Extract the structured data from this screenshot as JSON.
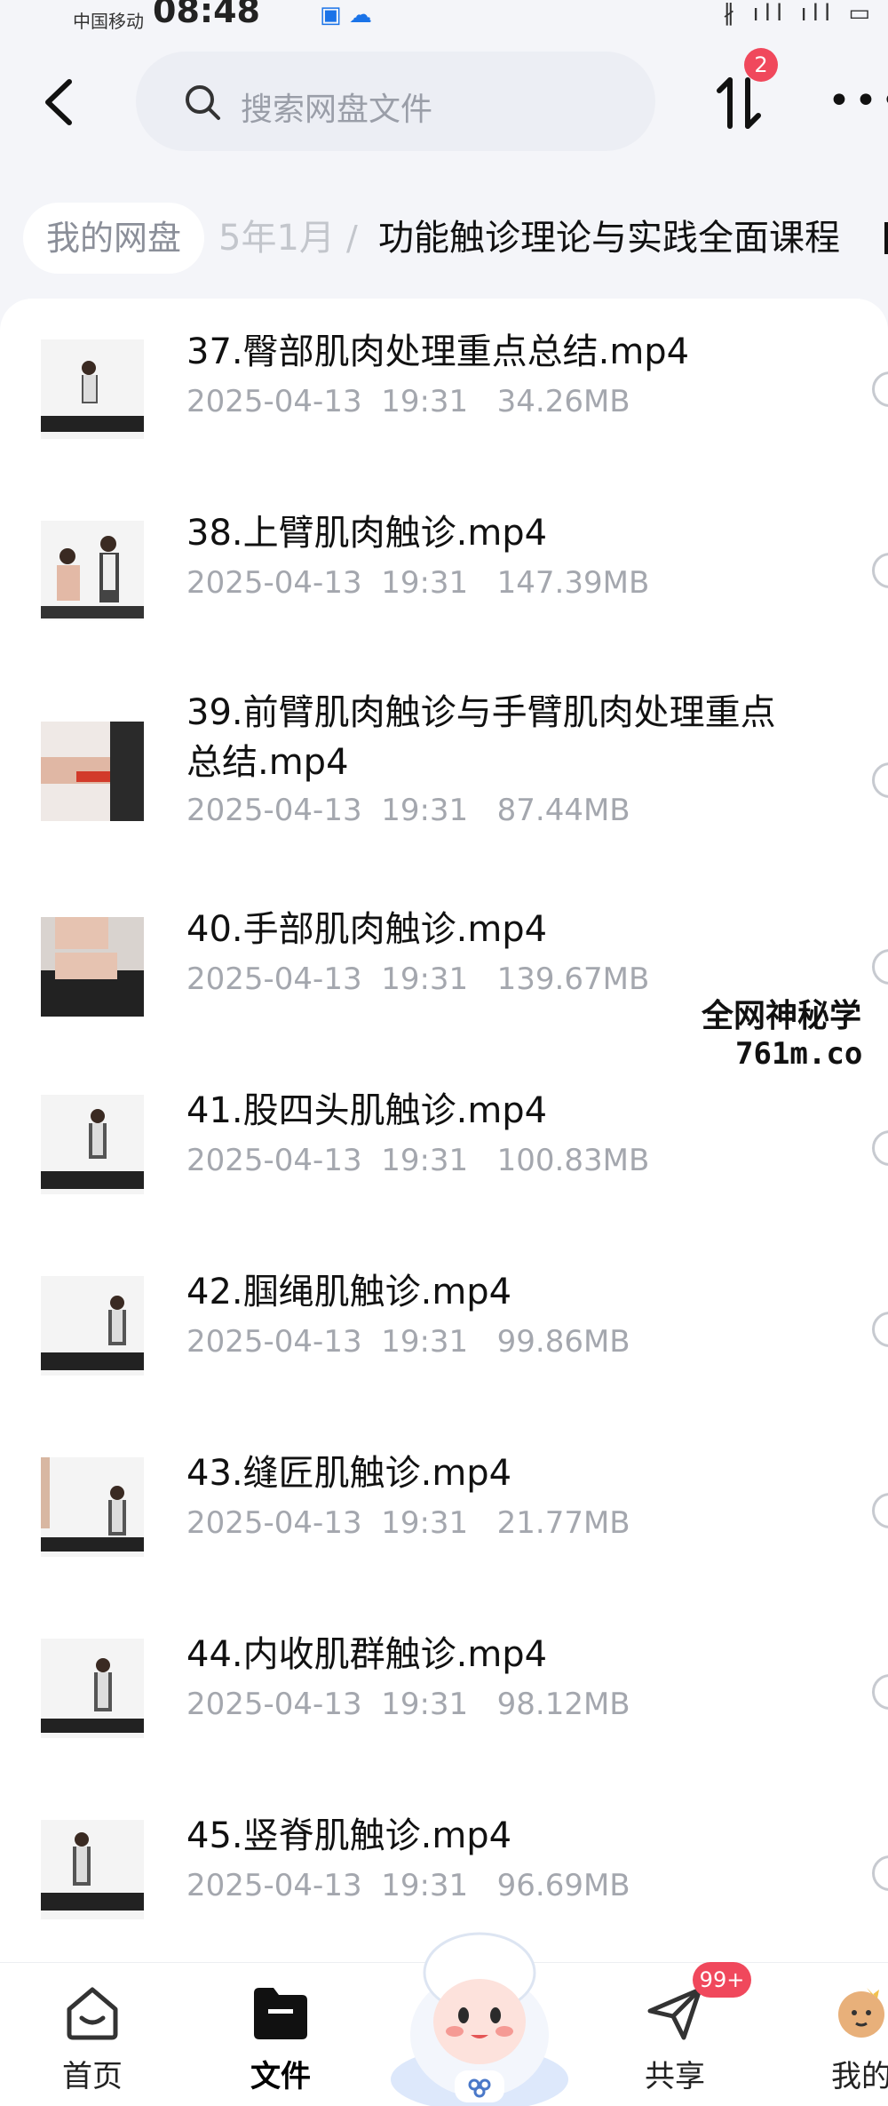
{
  "status_bar": {
    "carrier": "中国移动",
    "time": "08:48"
  },
  "top_bar": {
    "search_placeholder": "搜索网盘文件",
    "transfer_badge": "2"
  },
  "breadcrumb": {
    "root": "我的网盘",
    "middle": "5年1月",
    "separator": "/",
    "current": "功能触诊理论与实践全面课程"
  },
  "files": [
    {
      "name": "37.臀部肌肉处理重点总结.mp4",
      "date": "2025-04-13  19:31",
      "size": "34.26MB"
    },
    {
      "name": "38.上臂肌肉触诊.mp4",
      "date": "2025-04-13  19:31",
      "size": "147.39MB"
    },
    {
      "name": "39.前臂肌肉触诊与手臂肌肉处理重点总结.mp4",
      "date": "2025-04-13  19:31",
      "size": "87.44MB"
    },
    {
      "name": "40.手部肌肉触诊.mp4",
      "date": "2025-04-13  19:31",
      "size": "139.67MB"
    },
    {
      "name": "41.股四头肌触诊.mp4",
      "date": "2025-04-13  19:31",
      "size": "100.83MB"
    },
    {
      "name": "42.腘绳肌触诊.mp4",
      "date": "2025-04-13  19:31",
      "size": "99.86MB"
    },
    {
      "name": "43.缝匠肌触诊.mp4",
      "date": "2025-04-13  19:31",
      "size": "21.77MB"
    },
    {
      "name": "44.内收肌群触诊.mp4",
      "date": "2025-04-13  19:31",
      "size": "98.12MB"
    },
    {
      "name": "45.竖脊肌触诊.mp4",
      "date": "2025-04-13  19:31",
      "size": "96.69MB"
    }
  ],
  "watermark": {
    "line1": "全网神秘学",
    "line2": "761m.co"
  },
  "bottom_nav": {
    "home": "首页",
    "files": "文件",
    "share": "共享",
    "share_badge": "99+",
    "mine": "我的"
  },
  "colors": {
    "accent_badge": "#f0485c",
    "muted_text": "#a4a7ae"
  }
}
